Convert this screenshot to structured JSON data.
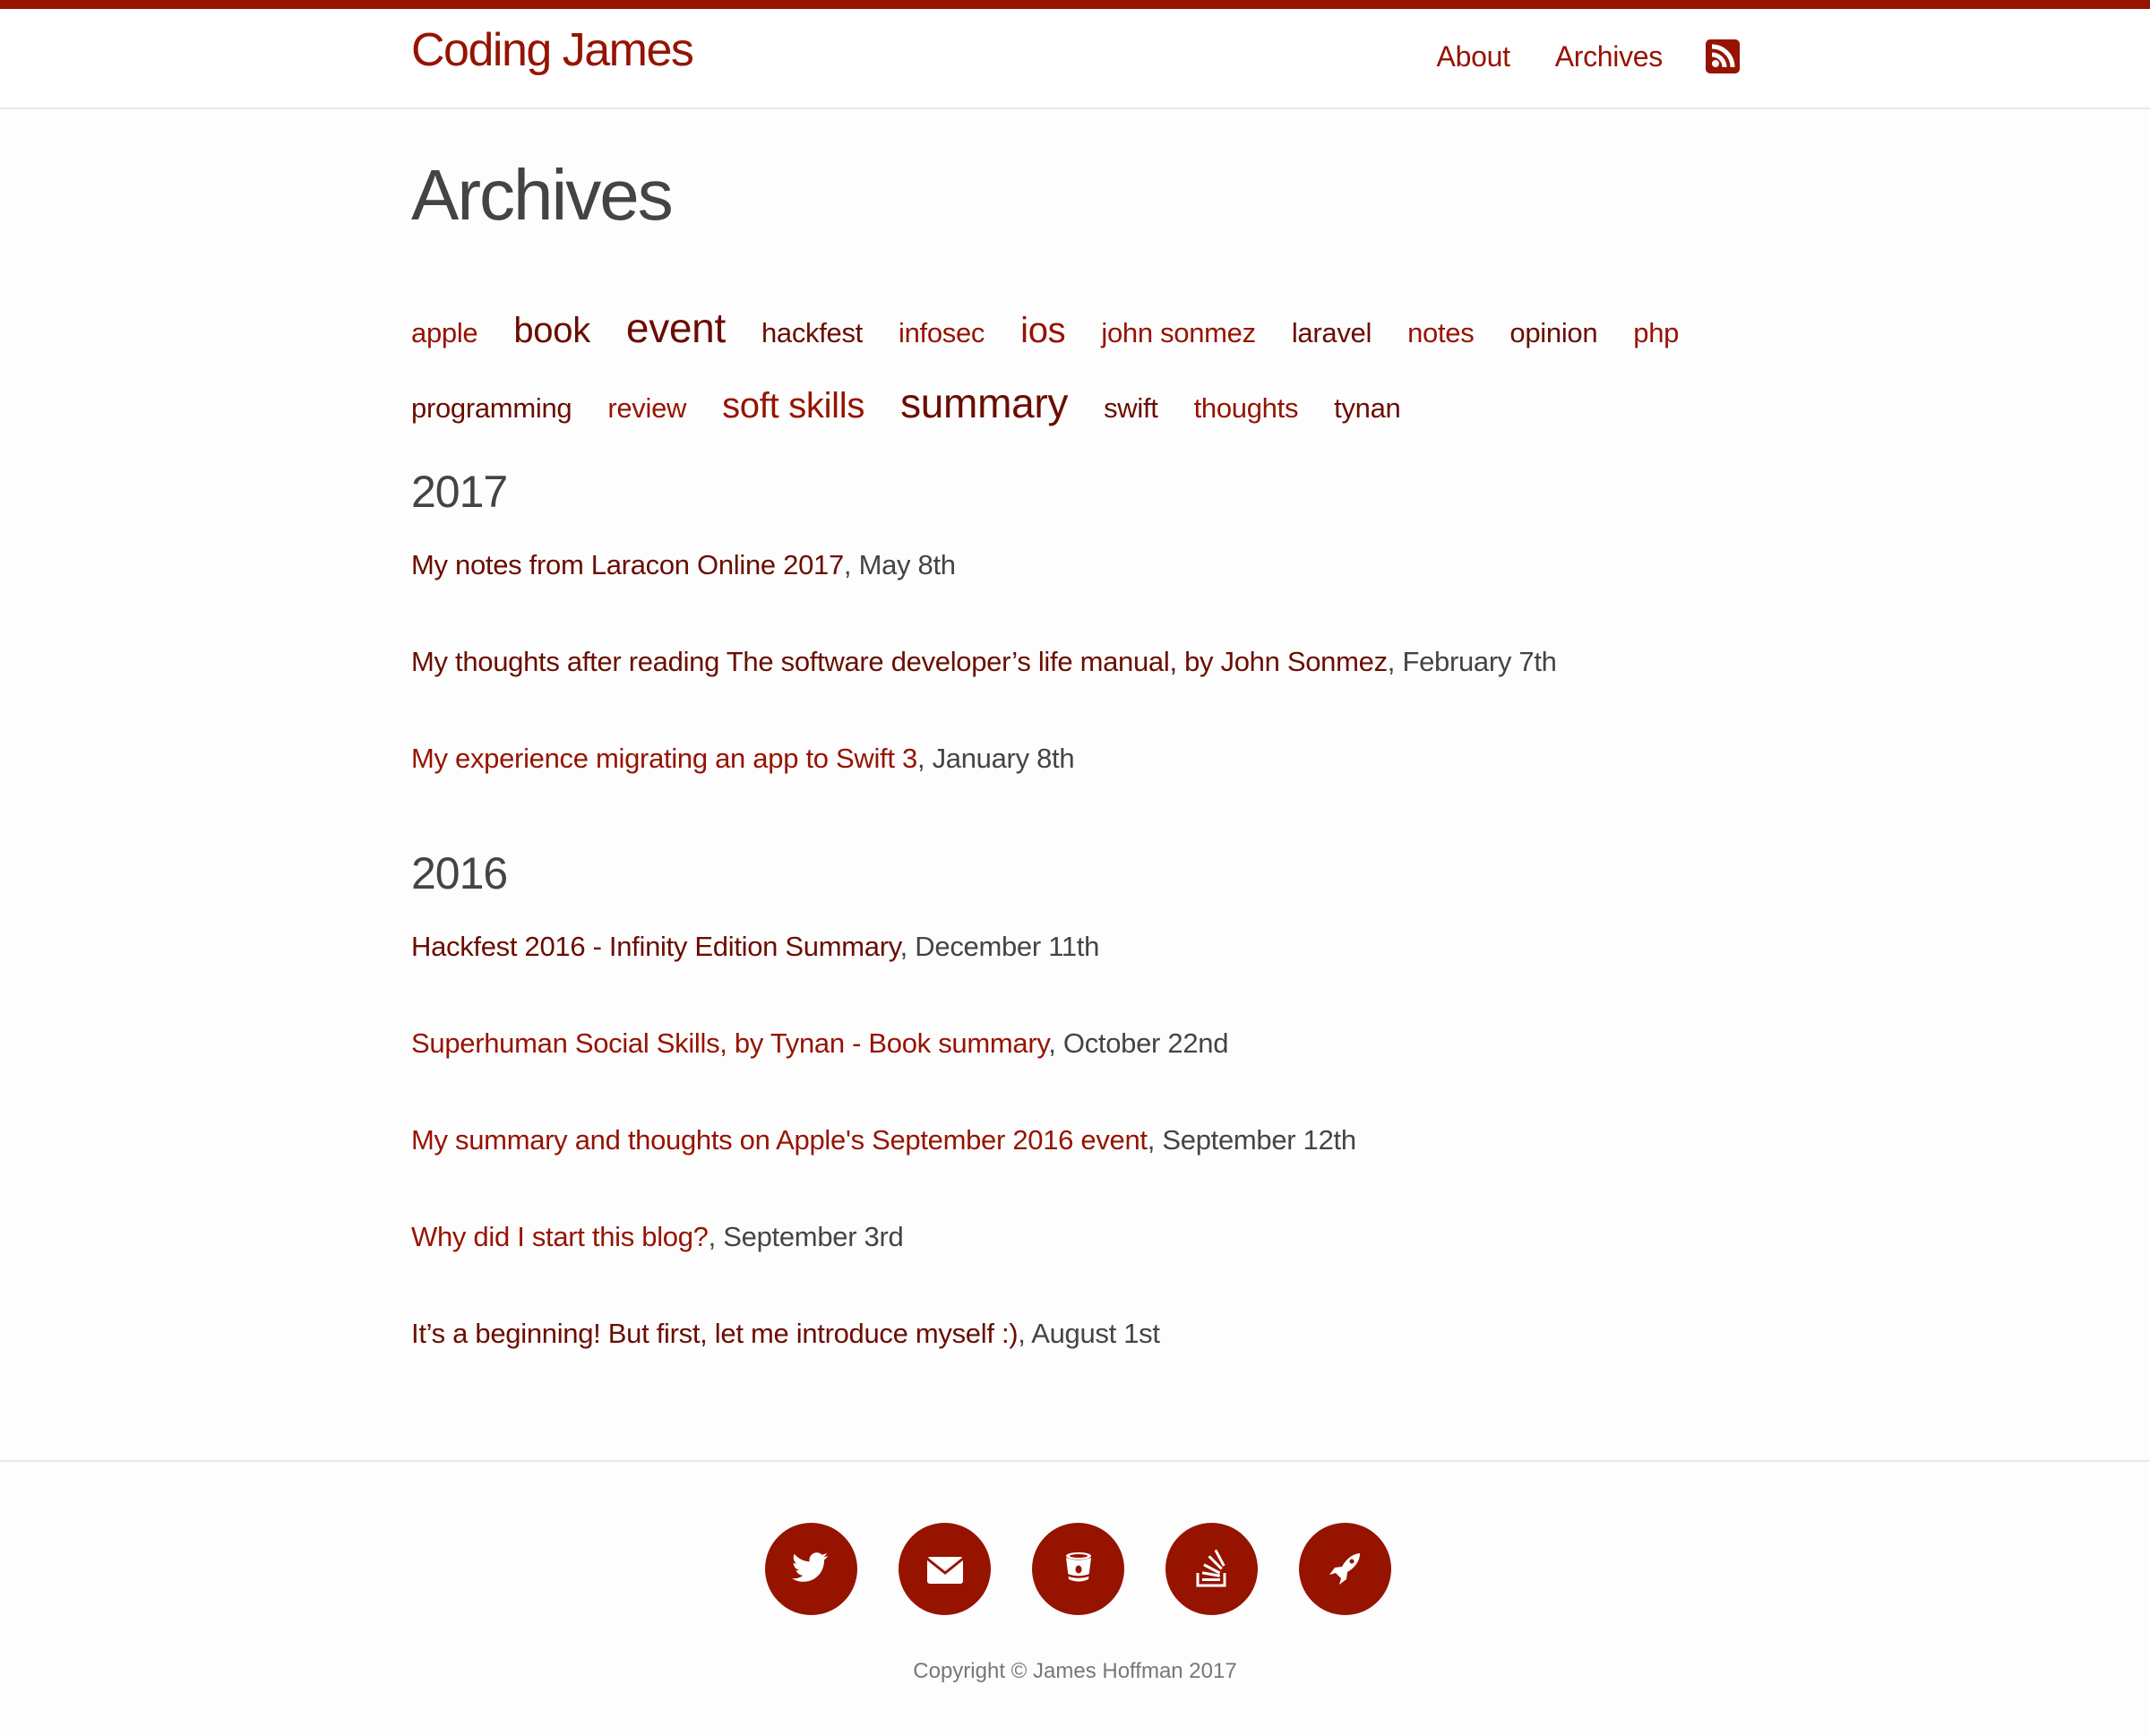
{
  "header": {
    "site_title": "Coding James",
    "nav": [
      {
        "label": "About"
      },
      {
        "label": "Archives"
      }
    ],
    "rss_icon": "rss-icon"
  },
  "colors": {
    "accent": "#961300",
    "accent_dark": "#6a0d00",
    "text": "#444444",
    "muted": "#777777",
    "border": "#e8e8e8"
  },
  "page": {
    "title": "Archives"
  },
  "tags": [
    {
      "label": "apple",
      "weight": "small",
      "tone": "bright"
    },
    {
      "label": "book",
      "weight": "large",
      "tone": "dark"
    },
    {
      "label": "event",
      "weight": "xlarge",
      "tone": "dark"
    },
    {
      "label": "hackfest",
      "weight": "small",
      "tone": "dark"
    },
    {
      "label": "infosec",
      "weight": "small",
      "tone": "bright"
    },
    {
      "label": "ios",
      "weight": "large",
      "tone": "bright"
    },
    {
      "label": "john sonmez",
      "weight": "small",
      "tone": "bright"
    },
    {
      "label": "laravel",
      "weight": "small",
      "tone": "dark"
    },
    {
      "label": "notes",
      "weight": "small",
      "tone": "bright"
    },
    {
      "label": "opinion",
      "weight": "small",
      "tone": "dark"
    },
    {
      "label": "php",
      "weight": "small",
      "tone": "bright"
    },
    {
      "label": "programming",
      "weight": "small",
      "tone": "dark"
    },
    {
      "label": "review",
      "weight": "small",
      "tone": "bright"
    },
    {
      "label": "soft skills",
      "weight": "large",
      "tone": "bright"
    },
    {
      "label": "summary",
      "weight": "xlarge",
      "tone": "dark"
    },
    {
      "label": "swift",
      "weight": "small",
      "tone": "dark"
    },
    {
      "label": "thoughts",
      "weight": "small",
      "tone": "bright"
    },
    {
      "label": "tynan",
      "weight": "small",
      "tone": "dark"
    }
  ],
  "years": [
    {
      "year": "2017",
      "posts": [
        {
          "title": "My notes from Laracon Online 2017",
          "date": "May 8th",
          "tone": "dark"
        },
        {
          "title": "My thoughts after reading The software developer’s life manual, by John Sonmez",
          "date": "February 7th",
          "tone": "dark"
        },
        {
          "title": "My experience migrating an app to Swift 3",
          "date": "January 8th",
          "tone": "bright"
        }
      ]
    },
    {
      "year": "2016",
      "posts": [
        {
          "title": "Hackfest 2016 - Infinity Edition Summary",
          "date": "December 11th",
          "tone": "dark"
        },
        {
          "title": "Superhuman Social Skills, by Tynan - Book summary",
          "date": "October 22nd",
          "tone": "bright"
        },
        {
          "title": "My summary and thoughts on Apple's September 2016 event",
          "date": "September 12th",
          "tone": "bright"
        },
        {
          "title": "Why did I start this blog?",
          "date": "September 3rd",
          "tone": "bright"
        },
        {
          "title": "It’s a beginning! But first, let me introduce myself :)",
          "date": "August 1st",
          "tone": "dark"
        }
      ]
    }
  ],
  "footer": {
    "social": [
      {
        "icon": "twitter-icon"
      },
      {
        "icon": "email-icon"
      },
      {
        "icon": "bitbucket-icon"
      },
      {
        "icon": "stackoverflow-icon"
      },
      {
        "icon": "rocket-icon"
      }
    ],
    "copyright": "Copyright © James Hoffman 2017"
  }
}
